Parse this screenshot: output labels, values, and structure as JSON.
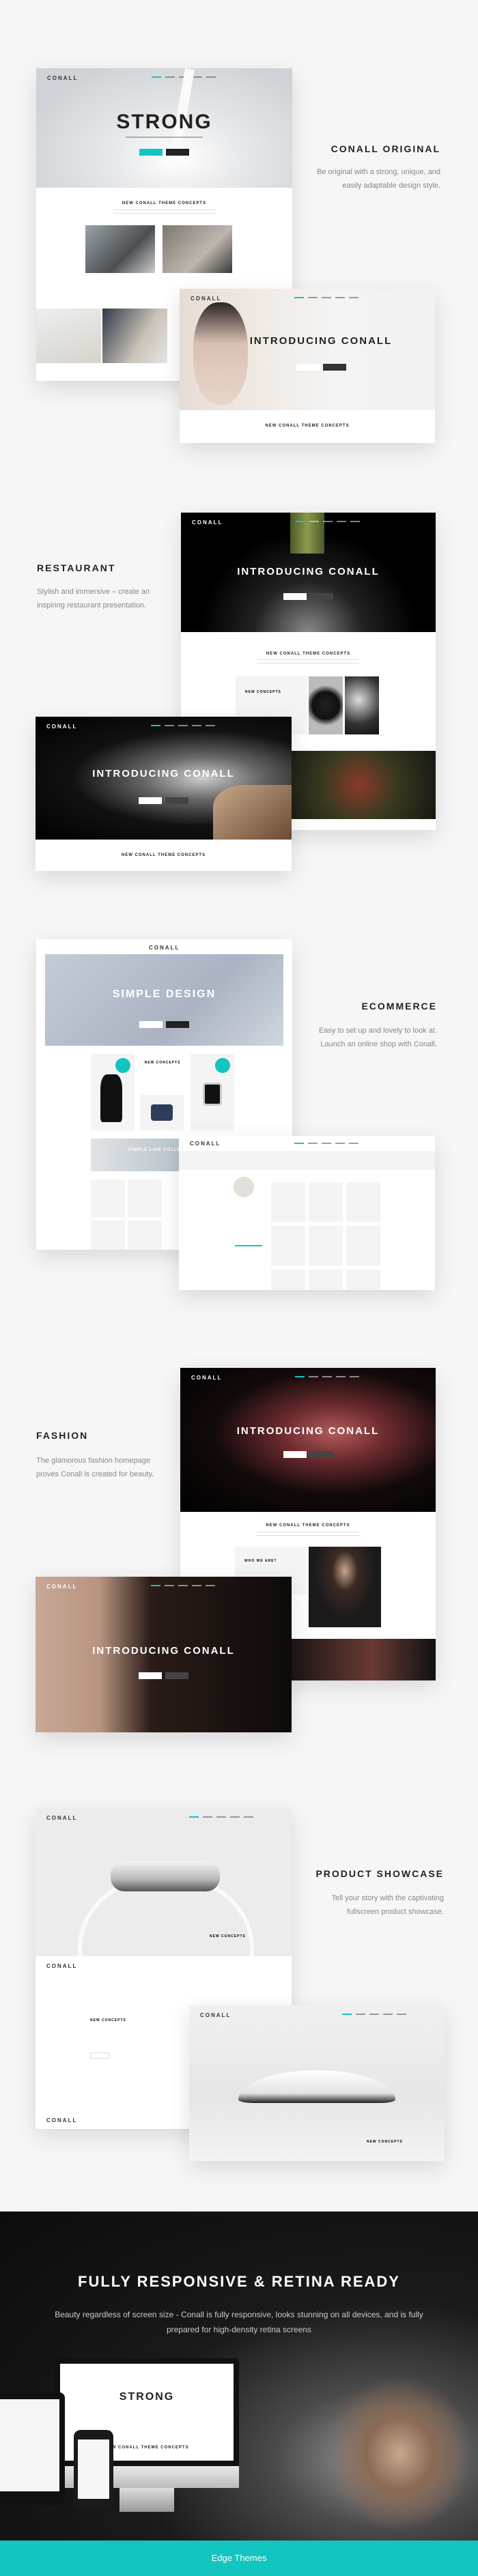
{
  "brand": {
    "logo": "CONALL",
    "accent": "#12c5c1"
  },
  "sections": [
    {
      "title": "CONALL ORIGINAL",
      "description": "Be original with a strong, unique, and easily adaptable design style."
    },
    {
      "title": "RESTAURANT",
      "description": "Stylish and immersive – create an inspiring restaurant presentation."
    },
    {
      "title": "ECOMMERCE",
      "description": "Easy to set up and lovely to look at. Launch an online shop with Conall."
    },
    {
      "title": "FASHION",
      "description": "The glamorous fashion homepage proves Conall is created for beauty."
    },
    {
      "title": "PRODUCT SHOWCASE",
      "description": "Tell your story with the captivating fullscreen product showcase."
    }
  ],
  "mockups": {
    "strong_headline": "STRONG",
    "intro_headline": "INTRODUCING CONALL",
    "concepts_title": "NEW CONALL THEME CONCEPTS",
    "simple_design": "SIMPLE DESIGN",
    "new_concepts": "NEW CONCEPTS",
    "simple_line": "SIMPLE LINE COLLECTION",
    "who_we_are": "WHO WE ARE?"
  },
  "responsive": {
    "title": "FULLY RESPONSIVE & RETINA READY",
    "description": "Beauty regardless of screen size - Conall is fully responsive, looks stunning on all devices, and is fully prepared for high-density retina screens"
  },
  "footer": {
    "label": "Edge Themes"
  }
}
